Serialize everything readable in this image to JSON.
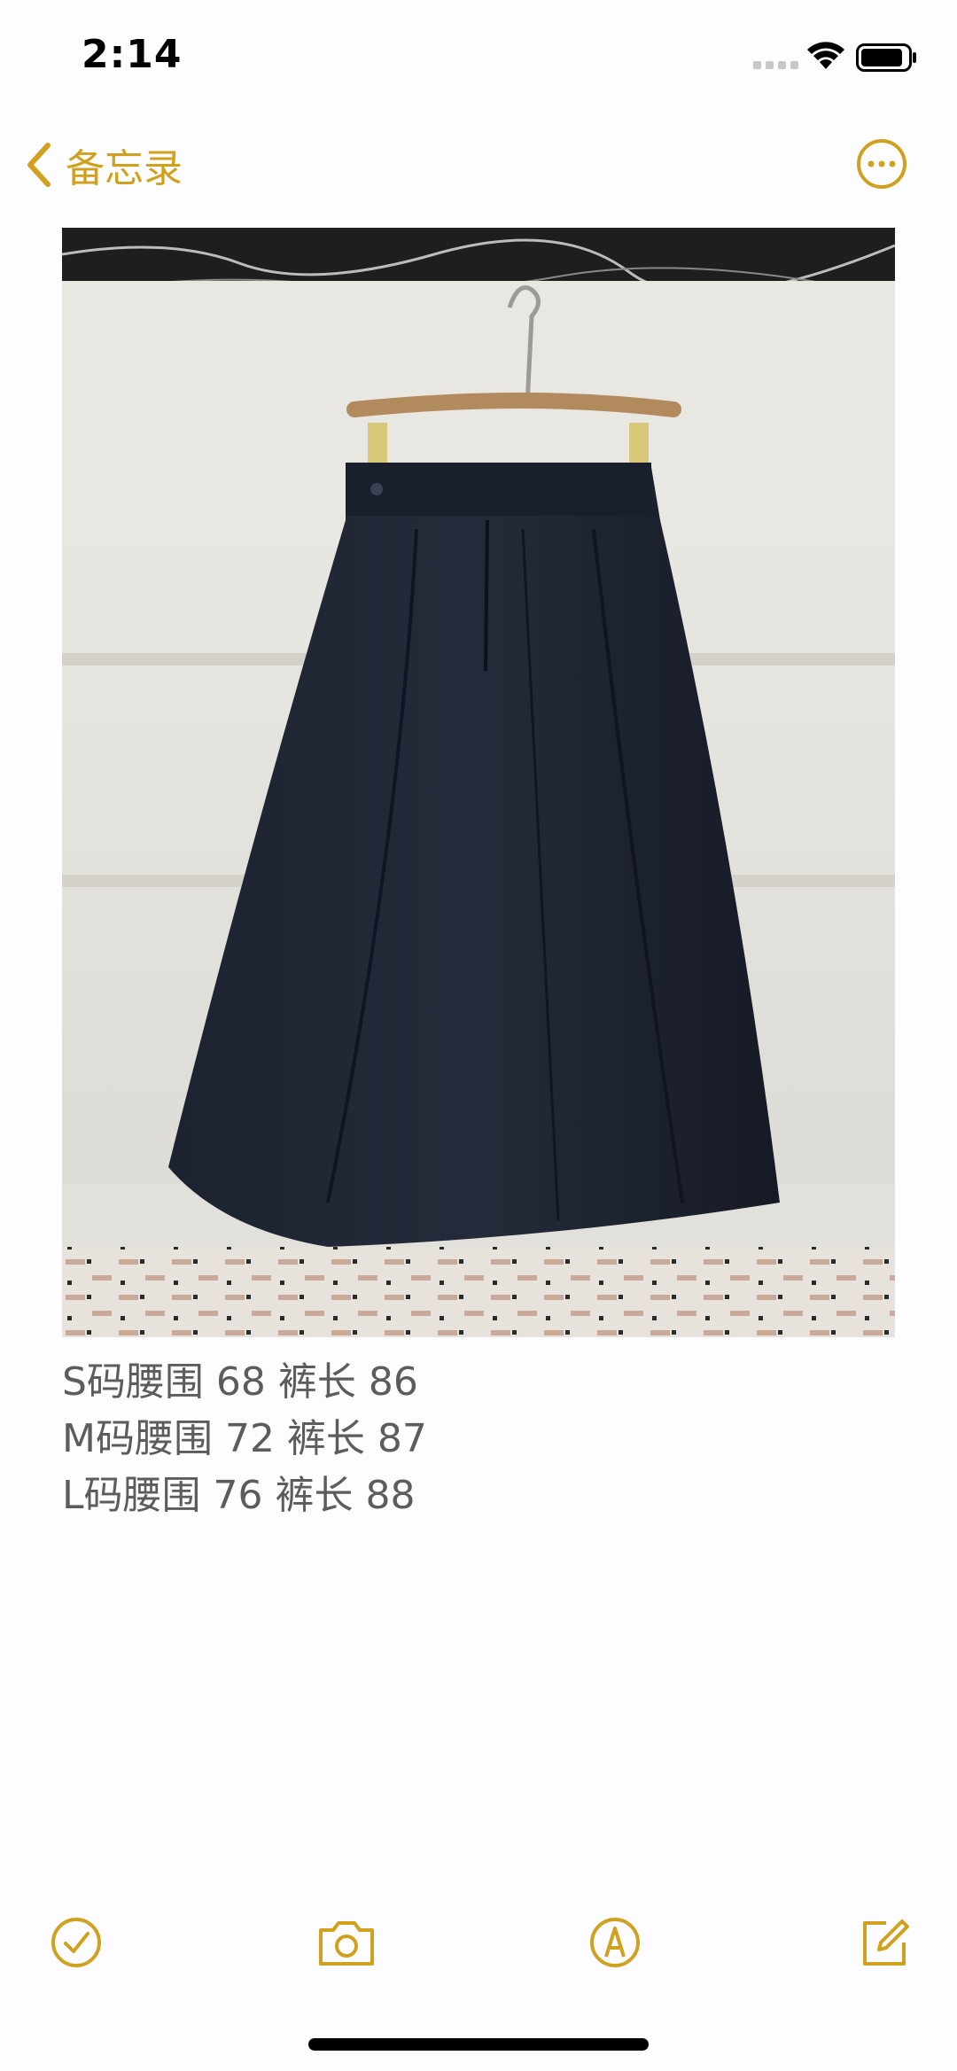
{
  "status_bar": {
    "time": "2:14",
    "icons": [
      "signal-icon",
      "wifi-icon",
      "battery-icon"
    ]
  },
  "nav": {
    "back_label": "备忘录",
    "back_icon": "chevron-left-icon",
    "more_icon": "more-ellipsis-icon"
  },
  "note": {
    "image_description_icon": "photo",
    "lines": [
      "S码腰围 68 裤长 86",
      "M码腰围 72 裤长 87",
      "L码腰围 76 裤长 88"
    ]
  },
  "toolbar": {
    "icons": [
      "checklist-icon",
      "camera-icon",
      "markup-icon",
      "compose-icon"
    ]
  },
  "colors": {
    "accent": "#d0a11f",
    "text": "#5c5c5c",
    "background": "#fdfcfe"
  }
}
